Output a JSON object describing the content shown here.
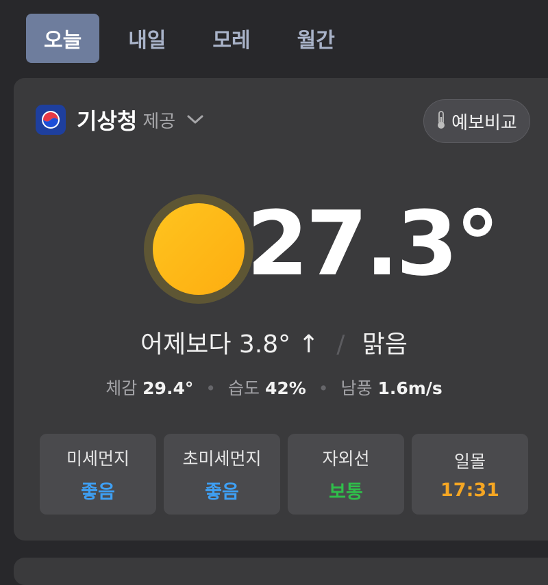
{
  "tabs": [
    {
      "label": "오늘",
      "active": true
    },
    {
      "label": "내일",
      "active": false
    },
    {
      "label": "모레",
      "active": false
    },
    {
      "label": "월간",
      "active": false
    }
  ],
  "provider": {
    "name": "기상청",
    "suffix": "제공",
    "icon": "kma-logo-icon"
  },
  "forecast_compare": {
    "label": "예보비교",
    "icon": "thermometer-icon"
  },
  "current": {
    "temperature": "27.3°",
    "condition_icon": "sun-icon",
    "vs_yesterday": "어제보다 3.8° ↑",
    "condition": "맑음"
  },
  "details": {
    "feels_label": "체감",
    "feels_value": "29.4°",
    "humidity_label": "습도",
    "humidity_value": "42%",
    "wind_label": "남풍",
    "wind_value": "1.6m/s"
  },
  "tiles": [
    {
      "label": "미세먼지",
      "value": "좋음",
      "color": "#3ea0f5"
    },
    {
      "label": "초미세먼지",
      "value": "좋음",
      "color": "#3ea0f5"
    },
    {
      "label": "자외선",
      "value": "보통",
      "color": "#2fbf4a"
    },
    {
      "label": "일몰",
      "value": "17:31",
      "color": "#f5a623"
    }
  ],
  "colors": {
    "background": "#28282b",
    "card": "#3a3a3c",
    "active_tab": "#6e7d9d",
    "sun": "#fdb813"
  }
}
